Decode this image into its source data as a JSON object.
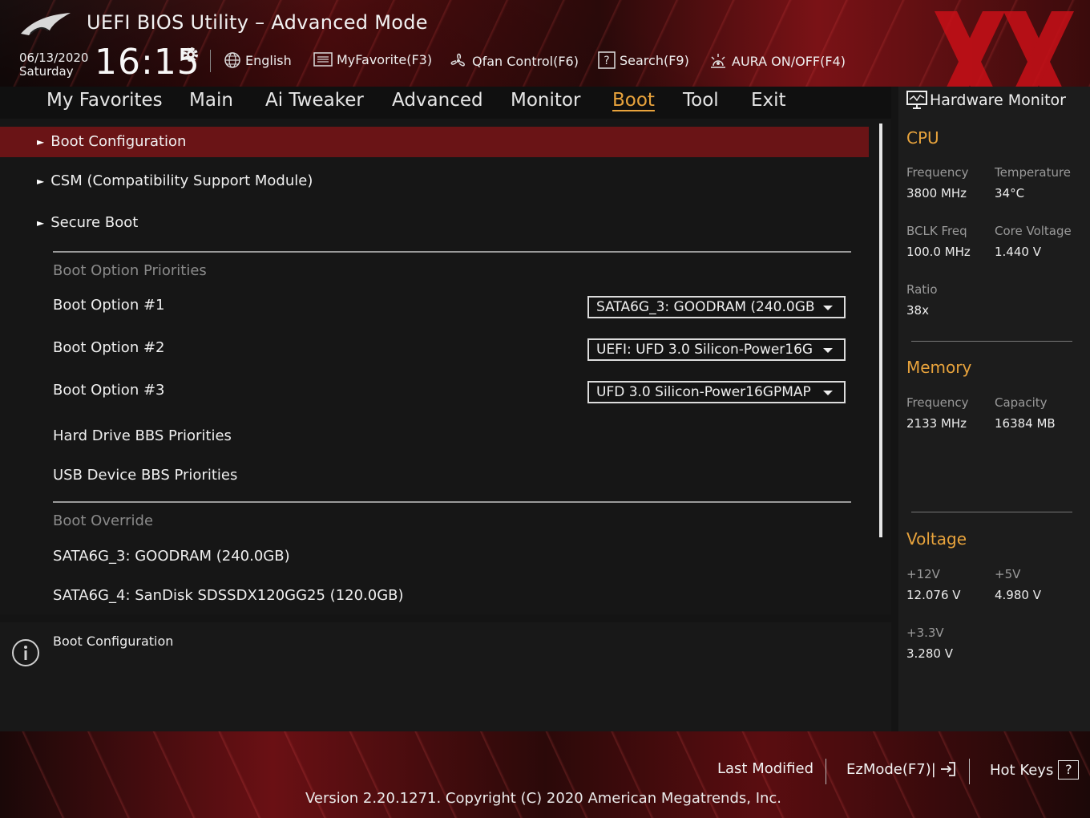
{
  "header": {
    "title": "UEFI BIOS Utility – Advanced Mode",
    "date": "06/13/2020",
    "day": "Saturday",
    "time": "16:15",
    "toolbar": [
      {
        "label": "English",
        "icon": "globe-icon"
      },
      {
        "label": "MyFavorite(F3)",
        "icon": "favorite-list-icon"
      },
      {
        "label": "Qfan Control(F6)",
        "icon": "fan-icon"
      },
      {
        "label": "Search(F9)",
        "icon": "search-help-icon"
      },
      {
        "label": "AURA ON/OFF(F4)",
        "icon": "aura-light-icon"
      }
    ]
  },
  "menu": {
    "tabs": [
      "My Favorites",
      "Main",
      "Ai Tweaker",
      "Advanced",
      "Monitor",
      "Boot",
      "Tool",
      "Exit"
    ],
    "active": "Boot"
  },
  "boot": {
    "submenus": [
      "Boot Configuration",
      "CSM (Compatibility Support Module)",
      "Secure Boot"
    ],
    "priorities_header": "Boot Option Priorities",
    "options": [
      {
        "label": "Boot Option #1",
        "value": "SATA6G_3: GOODRAM (240.0GB"
      },
      {
        "label": "Boot Option #2",
        "value": "UEFI: UFD 3.0 Silicon-Power16G"
      },
      {
        "label": "Boot Option #3",
        "value": "UFD 3.0 Silicon-Power16GPMAP"
      }
    ],
    "bbs": [
      "Hard Drive BBS Priorities",
      "USB Device BBS Priorities"
    ],
    "override_header": "Boot Override",
    "overrides": [
      "SATA6G_3: GOODRAM (240.0GB)",
      "SATA6G_4: SanDisk SDSSDX120GG25 (120.0GB)"
    ]
  },
  "help": {
    "text": "Boot Configuration"
  },
  "hardware_monitor": {
    "title": "Hardware Monitor",
    "cpu": {
      "title": "CPU",
      "frequency_label": "Frequency",
      "frequency": "3800 MHz",
      "temperature_label": "Temperature",
      "temperature": "34°C",
      "bclk_label": "BCLK Freq",
      "bclk": "100.0 MHz",
      "core_voltage_label": "Core Voltage",
      "core_voltage": "1.440 V",
      "ratio_label": "Ratio",
      "ratio": "38x"
    },
    "memory": {
      "title": "Memory",
      "frequency_label": "Frequency",
      "frequency": "2133 MHz",
      "capacity_label": "Capacity",
      "capacity": "16384 MB"
    },
    "voltage": {
      "title": "Voltage",
      "v12_label": "+12V",
      "v12": "12.076 V",
      "v5_label": "+5V",
      "v5": "4.980 V",
      "v33_label": "+3.3V",
      "v33": "3.280 V"
    }
  },
  "footer": {
    "last_modified": "Last Modified",
    "ezmode": "EzMode(F7)|",
    "hotkeys": "Hot Keys",
    "hotkeys_key": "?",
    "version": "Version 2.20.1271. Copyright (C) 2020 American Megatrends, Inc."
  },
  "colors": {
    "accent": "#e8a33c",
    "selected_row": "#6a1416"
  }
}
